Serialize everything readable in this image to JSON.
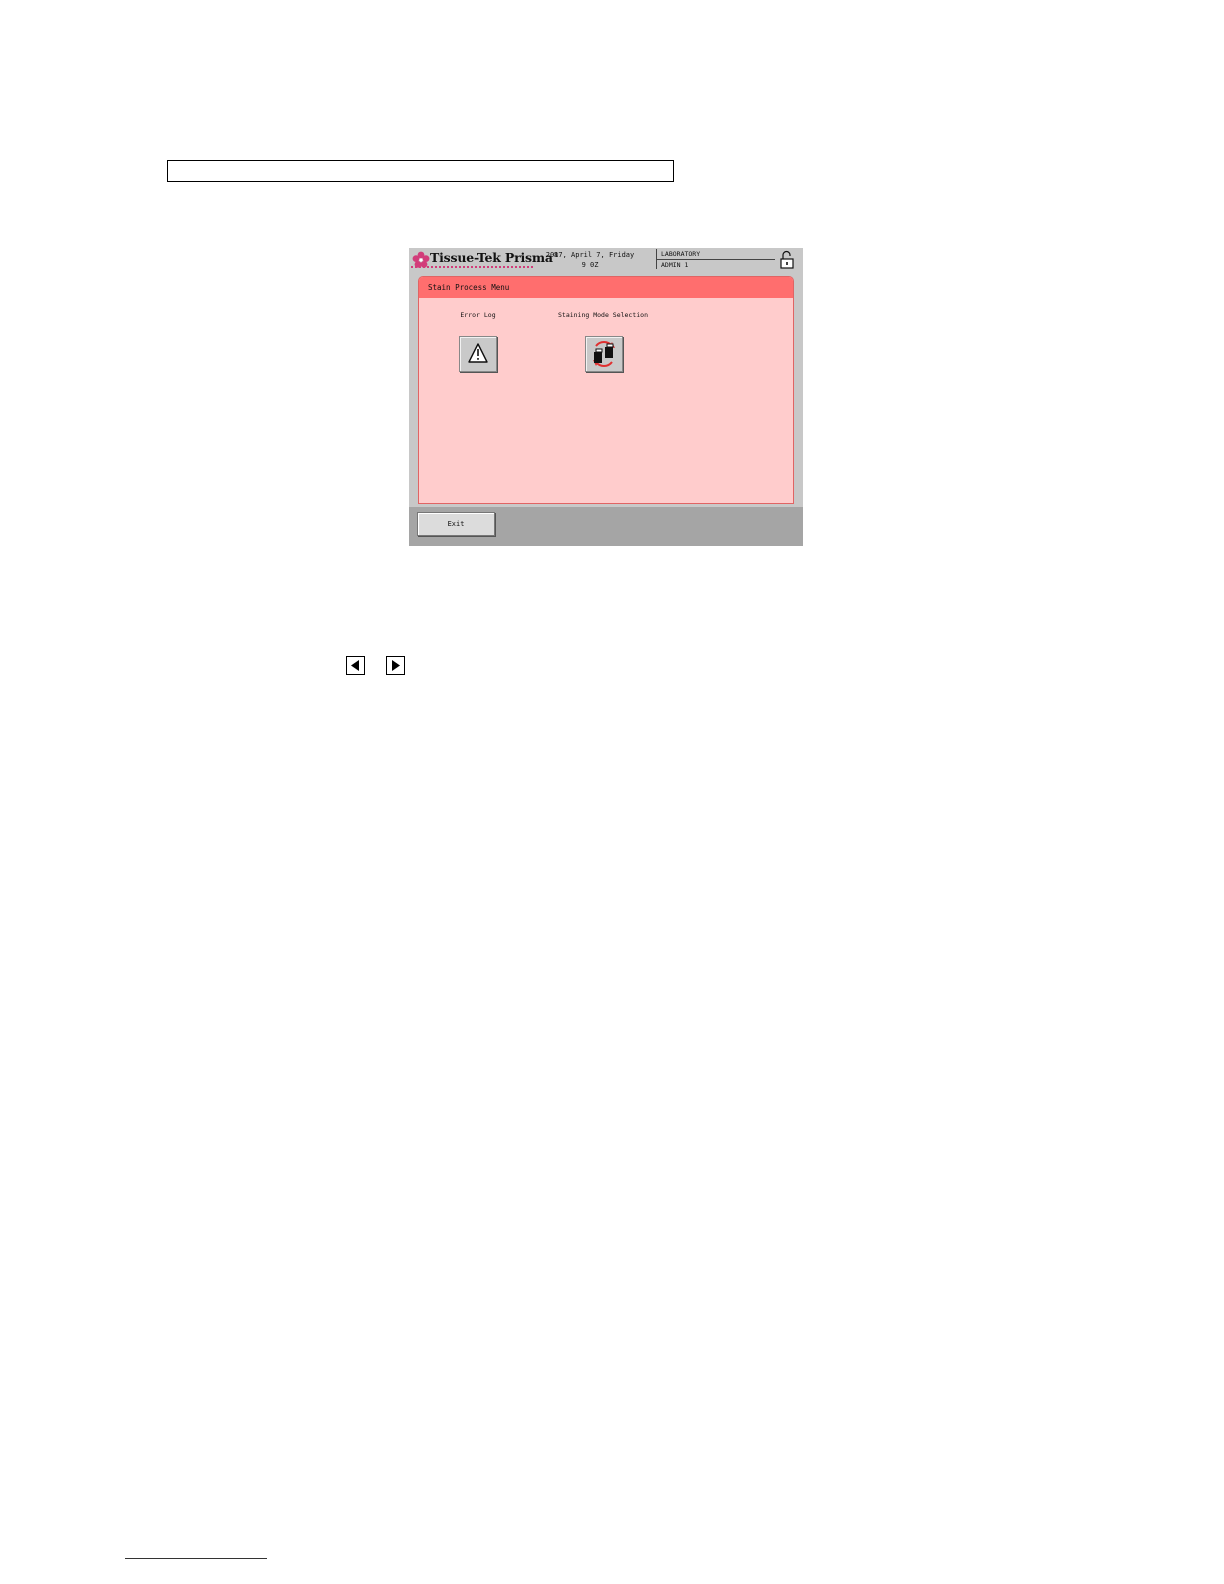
{
  "header": {
    "brand": "Tissue-Tek Prisma",
    "brand_mark": "®",
    "date_line1": "2017, April 7, Friday",
    "date_line2": "9 0Z",
    "location": "LABORATORY",
    "user": "ADMIN 1",
    "lock_icon": "unlocked-padlock-icon"
  },
  "panel": {
    "title": "Stain Process Menu",
    "tiles": [
      {
        "label": "Error Log",
        "icon": "warning-icon"
      },
      {
        "label": "Staining Mode Selection",
        "icon": "mode-switch-icon"
      }
    ]
  },
  "footer": {
    "exit_label": "Exit"
  },
  "nav": {
    "prev_icon": "triangle-left-icon",
    "next_icon": "triangle-right-icon"
  },
  "colors": {
    "panel_bg": "#ffcccc",
    "panel_bar": "#ff6e6e",
    "screen_bg": "#c8c8c8",
    "footer_bg": "#a5a5a5",
    "brand_accent": "#d23c7a"
  }
}
